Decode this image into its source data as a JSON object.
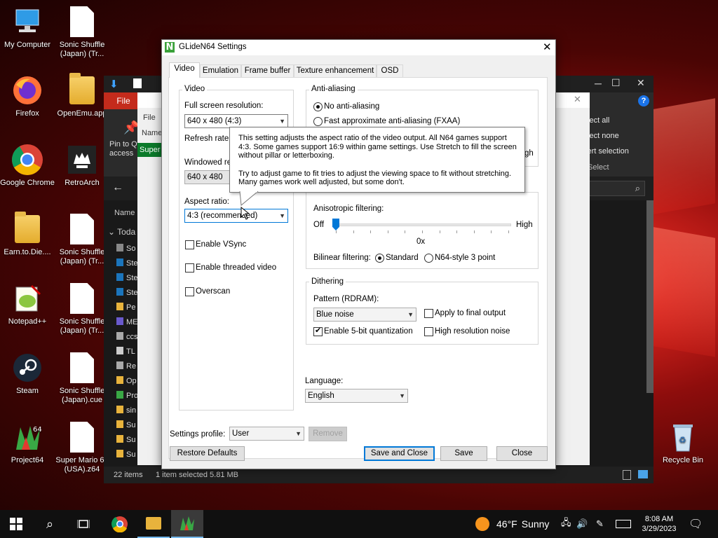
{
  "desktop": {
    "icons_left": [
      {
        "label": "My Computer",
        "icon": "computer-icon"
      },
      {
        "label": "Firefox",
        "icon": "firefox-icon"
      },
      {
        "label": "Google Chrome",
        "icon": "chrome-icon"
      },
      {
        "label": "Earn.to.Die....",
        "icon": "folder-icon"
      },
      {
        "label": "Notepad++",
        "icon": "notepad-plus-plus-icon"
      },
      {
        "label": "Steam",
        "icon": "steam-icon"
      },
      {
        "label": "Project64",
        "icon": "project64-icon"
      }
    ],
    "icons_col2": [
      {
        "label": "Sonic Shuffle (Japan) (Tr...",
        "icon": "file-icon"
      },
      {
        "label": "OpenEmu.app",
        "icon": "folder-icon"
      },
      {
        "label": "RetroArch",
        "icon": "retroarch-icon"
      },
      {
        "label": "Sonic Shuffle (Japan) (Tr...",
        "icon": "file-icon"
      },
      {
        "label": "Sonic Shuffle (Japan) (Tr...",
        "icon": "file-icon"
      },
      {
        "label": "Sonic Shuffle (Japan).cue",
        "icon": "file-icon"
      },
      {
        "label": "Super Mario 64 (USA).z64",
        "icon": "file-icon"
      }
    ],
    "recycle_bin": "Recycle Bin"
  },
  "explorer": {
    "file_tab": "File",
    "inner_file": "File",
    "pin_label": "Pin to Qu access",
    "name_col": "Name",
    "selected_row": "Super",
    "nav_name": "Name",
    "today": "Toda",
    "select_all": "elect all",
    "select_none": "elect none",
    "invert_selection": "vert selection",
    "select_group": "Select",
    "left_rows": [
      "So",
      "Ste",
      "Ste",
      "Ste",
      "Pe",
      "ME",
      "ccs",
      "TL",
      "Re",
      "Op",
      "Pro",
      "sin",
      "Su",
      "Su",
      "Su"
    ],
    "status_items": "22 items",
    "status_selected": "1 item selected  5.81 MB"
  },
  "dialog": {
    "title": "GLideN64 Settings",
    "tabs": [
      "Video",
      "Emulation",
      "Frame buffer",
      "Texture enhancement",
      "OSD"
    ],
    "video_group": "Video",
    "fullscreen_label": "Full screen resolution:",
    "fullscreen_value": "640 x 480 (4:3)",
    "refresh_label": "Refresh rate:",
    "windowed_label": "Windowed res",
    "windowed_value": "640 x 480",
    "aspect_label": "Aspect ratio:",
    "aspect_value": "4:3 (recommended)",
    "vsync_label": "Enable VSync",
    "threaded_label": "Enable threaded video",
    "overscan_label": "Overscan",
    "aa_group": "Anti-aliasing",
    "aa_none": "No anti-aliasing",
    "aa_fxaa": "Fast approximate anti-aliasing (FXAA)",
    "aa_hidden_fragment": "gh",
    "filtering_group": "Filtering",
    "aniso_label": "Anisotropic filtering:",
    "aniso_off": "Off",
    "aniso_high": "High",
    "aniso_value": "0x",
    "aniso_level": 0,
    "bilinear_label": "Bilinear filtering:",
    "bilinear_standard": "Standard",
    "bilinear_n64": "N64-style 3 point",
    "dithering_group": "Dithering",
    "pattern_label": "Pattern (RDRAM):",
    "pattern_value": "Blue noise",
    "apply_final": "Apply to final output",
    "enable_5bit": "Enable 5-bit quantization",
    "high_res_noise": "High resolution noise",
    "language_label": "Language:",
    "language_value": "English",
    "profile_label": "Settings profile:",
    "profile_value": "User",
    "remove": "Remove",
    "restore_defaults": "Restore Defaults",
    "save_close": "Save and Close",
    "save": "Save",
    "close": "Close",
    "tooltip_p1": "This setting adjusts the aspect ratio of the video output. All N64 games support 4:3. Some games support 16:9 within game settings. Use Stretch to fill the screen without pillar or letterboxing.",
    "tooltip_p2": "Try to adjust game to fit tries to adjust the viewing space to fit without stretching. Many games work well adjusted, but some don't."
  },
  "taskbar": {
    "weather_temp": "46°F",
    "weather_text": "Sunny",
    "time": "8:08 AM",
    "date": "3/29/2023"
  }
}
